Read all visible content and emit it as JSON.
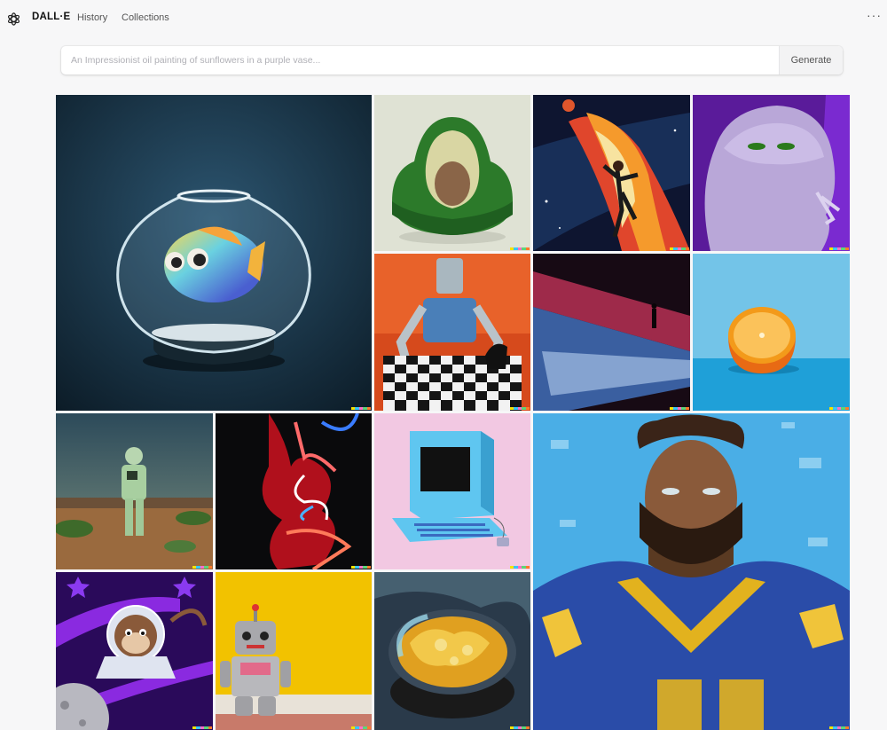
{
  "header": {
    "brand": "DALL·E",
    "nav": [
      "History",
      "Collections"
    ],
    "more_icon": "ellipsis-icon"
  },
  "prompt": {
    "placeholder": "An Impressionist oil painting of sunflowers in a purple vase...",
    "value": "",
    "generate_label": "Generate"
  },
  "colors": {
    "background": "#f7f7f8",
    "signature": [
      "#f5e200",
      "#37c6ff",
      "#ff6ec7",
      "#5bd67a",
      "#ff7a2b"
    ]
  }
}
